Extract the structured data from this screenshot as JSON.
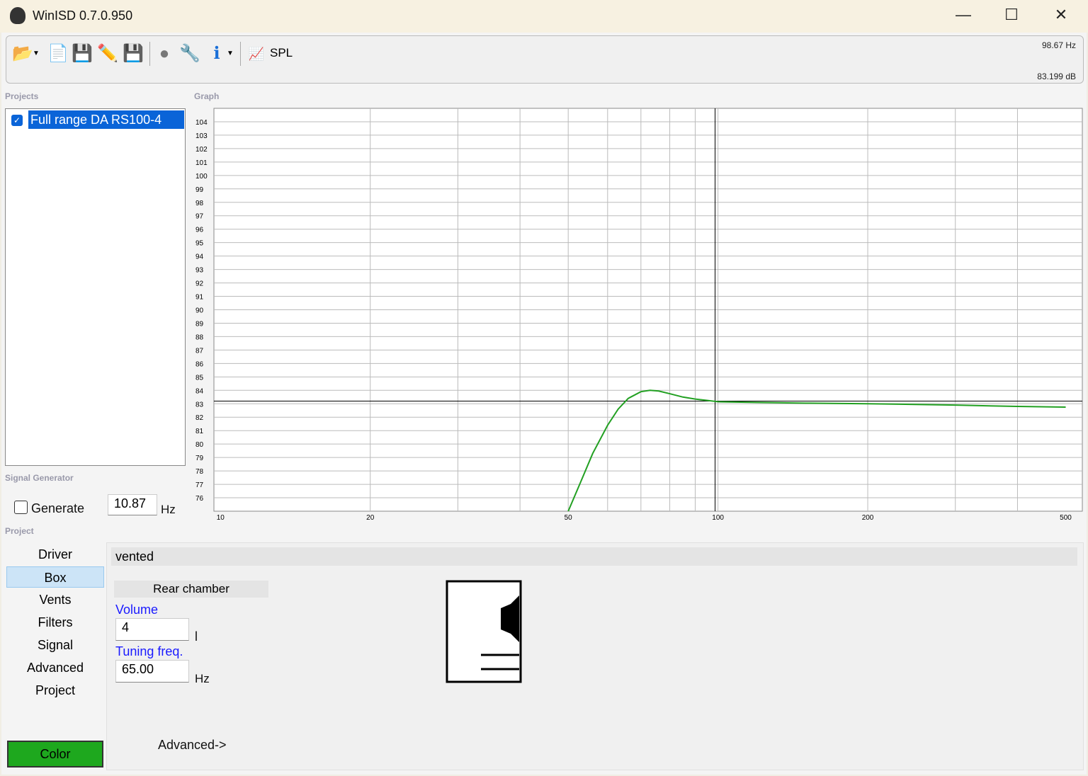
{
  "window": {
    "title": "WinISD 0.7.0.950",
    "minimize": "—",
    "maximize": "☐",
    "close": "✕"
  },
  "toolbar": {
    "spl_label": "SPL",
    "freq_readout": "98.67 Hz",
    "db_readout": "83.199 dB"
  },
  "sections": {
    "projects": "Projects",
    "graph": "Graph",
    "signal_generator": "Signal Generator",
    "project": "Project"
  },
  "projects": [
    {
      "name": "Full range DA RS100-4",
      "checked": true
    }
  ],
  "signal": {
    "generate_label": "Generate",
    "frequency": "10.87",
    "unit": "Hz"
  },
  "nav": [
    "Driver",
    "Box",
    "Vents",
    "Filters",
    "Signal",
    "Advanced",
    "Project"
  ],
  "nav_selected": "Box",
  "box": {
    "type": "vented",
    "rear_chamber": "Rear chamber",
    "volume_label": "Volume",
    "volume": "4",
    "volume_unit": "l",
    "tuning_label": "Tuning freq.",
    "tuning": "65.00",
    "tuning_unit": "Hz",
    "advanced": "Advanced->"
  },
  "color_button": "Color",
  "colors": {
    "curve": "#22a022",
    "selection": "#0a64d8",
    "color_button": "#1ea81e"
  },
  "chart_data": {
    "type": "line",
    "xscale": "log",
    "xlim": [
      9.7,
      540
    ],
    "ylim": [
      75,
      105
    ],
    "x_ticks": [
      10,
      20,
      50,
      100,
      200,
      500
    ],
    "x_tick_labels": [
      "10",
      "20",
      "50",
      "100",
      "200",
      "500"
    ],
    "x_grid": [
      20,
      30,
      40,
      50,
      60,
      70,
      80,
      90,
      100,
      200,
      300,
      400
    ],
    "y_ticks": [
      104,
      103,
      102,
      101,
      100,
      99,
      98,
      97,
      96,
      95,
      94,
      93,
      92,
      91,
      90,
      89,
      88,
      87,
      86,
      85,
      84,
      83,
      82,
      81,
      80,
      79,
      78,
      77,
      76
    ],
    "cursor": {
      "x": 98.67,
      "y": 83.199
    },
    "series": [
      {
        "name": "Full range DA RS100-4",
        "x": [
          50,
          53,
          56,
          60,
          63,
          66,
          70,
          73,
          76,
          80,
          85,
          90,
          95,
          100,
          120,
          150,
          200,
          250,
          300,
          400,
          500
        ],
        "y": [
          75,
          77.2,
          79.3,
          81.4,
          82.6,
          83.4,
          83.9,
          84,
          83.95,
          83.75,
          83.5,
          83.35,
          83.25,
          83.15,
          83.1,
          83.05,
          83.0,
          82.95,
          82.9,
          82.8,
          82.75
        ]
      }
    ]
  }
}
